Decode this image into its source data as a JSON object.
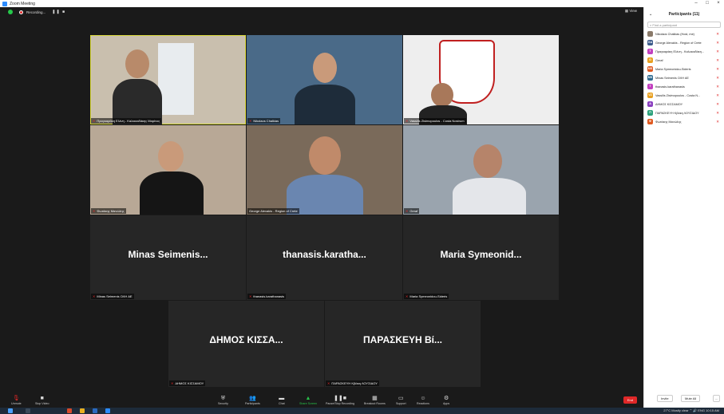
{
  "window": {
    "title": "Zoom Meeting",
    "controls": [
      "–",
      "□",
      "×"
    ]
  },
  "meeting_bar": {
    "recording_label": "Recording...",
    "pause_label": "❚❚ ■",
    "view_label": "▦ View"
  },
  "tiles": [
    {
      "name": "Πραγκαράκη Ελένη - Καλοκαιδάκης Μαρίνος",
      "video": true
    },
    {
      "name": "Nikolaos Chalkias",
      "video": true
    },
    {
      "name": "Vassilis Zisimopoulos - Costa Nostrum",
      "video": true
    },
    {
      "name": "Φωτάκης Μανώλης",
      "video": true
    },
    {
      "name": "George Alexakis - Region of Crete",
      "video": true
    },
    {
      "name": "Geraf",
      "video": true
    },
    {
      "name": "Minas Seimenis ΟΛΗ ΑΕ",
      "display": "Minas  Seimenis...",
      "video": false
    },
    {
      "name": "thanasis.karathanasis",
      "display": "thanasis.karatha...",
      "video": false
    },
    {
      "name": "Maria Symeonidou-Sideris",
      "display": "Maria  Symeonid...",
      "video": false
    },
    {
      "name": "ΔΗΜΟΣ ΚΙΣΣΑΜΟΥ",
      "display": "ΔΗΜΟΣ  ΚΙΣΣΑ...",
      "video": false
    },
    {
      "name": "ΠΑΡΑΣΚΕΥΗ Κβάκη ΛΟΥΣΙΔΟΥ",
      "display": "ΠΑΡΑΣΚΕΥΗ  Βί...",
      "video": false
    }
  ],
  "toolbar": {
    "unmute": "Unmute",
    "stop_video": "Stop Video",
    "security": "Security",
    "participants": "Participants",
    "participants_count": "11",
    "chat": "Chat",
    "share_screen": "Share Screen",
    "record": "Pause/Stop Recording",
    "breakout": "Breakout Rooms",
    "support": "Support",
    "reactions": "Reactions",
    "apps": "Apps",
    "end": "End"
  },
  "panel": {
    "title": "Participants (11)",
    "search_placeholder": "Find a participant",
    "participants": [
      {
        "initials": "",
        "name": "Nikolaos Chalkias (Host, me)",
        "color": "#8a7a6a"
      },
      {
        "initials": "GA",
        "name": "George Alexakis - Region of Crete",
        "color": "#3a5a8a"
      },
      {
        "initials": "T",
        "name": "Πραγκαράκη Ελένη - Καλοκαιδάκη...",
        "color": "#c23fbf"
      },
      {
        "initials": "G",
        "name": "Geraf",
        "color": "#e8a020"
      },
      {
        "initials": "MS",
        "name": "Maria Symeonidou-Sideris",
        "color": "#e05a20"
      },
      {
        "initials": "MS",
        "name": "Minas Seimenis ΟΛΗ ΑΕ",
        "color": "#2f6a8f"
      },
      {
        "initials": "T",
        "name": "thanasis.karathanasis",
        "color": "#c23fbf"
      },
      {
        "initials": "VZ",
        "name": "Vassilis Zisimopoulos - Costa N...",
        "color": "#e8a020"
      },
      {
        "initials": "Δ",
        "name": "ΔΗΜΟΣ ΚΙΣΣΑΜΟΥ",
        "color": "#8a3fbf"
      },
      {
        "initials": "Π",
        "name": "ΠΑΡΑΣΚΕΥΗ Κβάκη ΛΟΥΣΙΔΟΥ",
        "color": "#2aa07a"
      },
      {
        "initials": "Φ",
        "name": "Φωτάκης Μανώλης",
        "color": "#e05a20"
      }
    ],
    "invite": "Invite",
    "mute_all": "Mute All",
    "more": "..."
  },
  "taskbar": {
    "tray_text": "27°C  Mostly clear   ⌃  🔊  ENG",
    "time": "10:15 AM"
  }
}
